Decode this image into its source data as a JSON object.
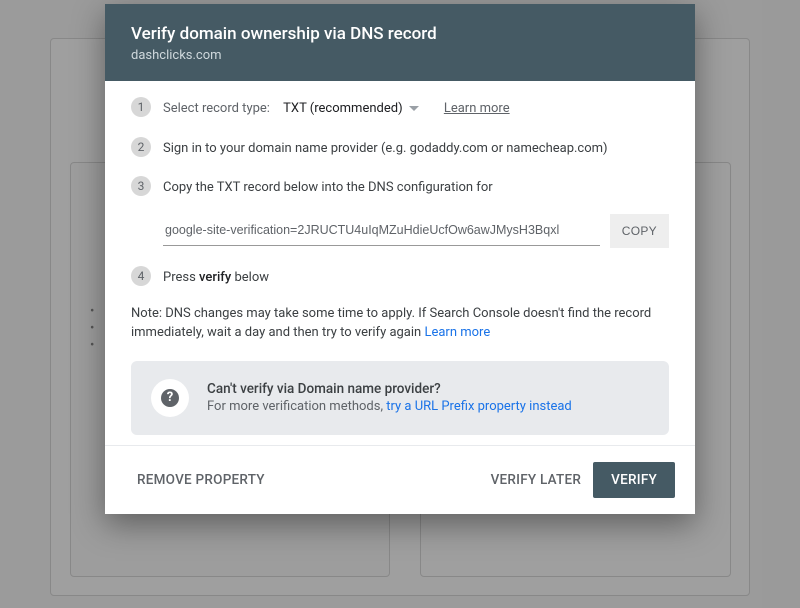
{
  "modal": {
    "title": "Verify domain ownership via DNS record",
    "subtitle": "dashclicks.com",
    "steps": {
      "s1_label": "Select record type:",
      "s1_value": "TXT (recommended)",
      "s1_learn": "Learn more",
      "s2": "Sign in to your domain name provider (e.g. godaddy.com or namecheap.com)",
      "s3": "Copy the TXT record below into the DNS configuration for",
      "txt_value": "google-site-verification=2JRUCTU4uIqMZuHdieUcfOw6awJMysH3Bqxl",
      "copy": "COPY",
      "s4_prefix": "Press ",
      "s4_bold": "verify",
      "s4_suffix": " below"
    },
    "note_text": "Note: DNS changes may take some time to apply. If Search Console doesn't find the record immediately, wait a day and then try to verify again ",
    "note_link": "Learn more",
    "alt": {
      "title": "Can't verify via Domain name provider?",
      "text": "For more verification methods, ",
      "link": "try a URL Prefix property instead"
    },
    "footer": {
      "remove": "REMOVE PROPERTY",
      "later": "VERIFY LATER",
      "verify": "VERIFY"
    }
  }
}
